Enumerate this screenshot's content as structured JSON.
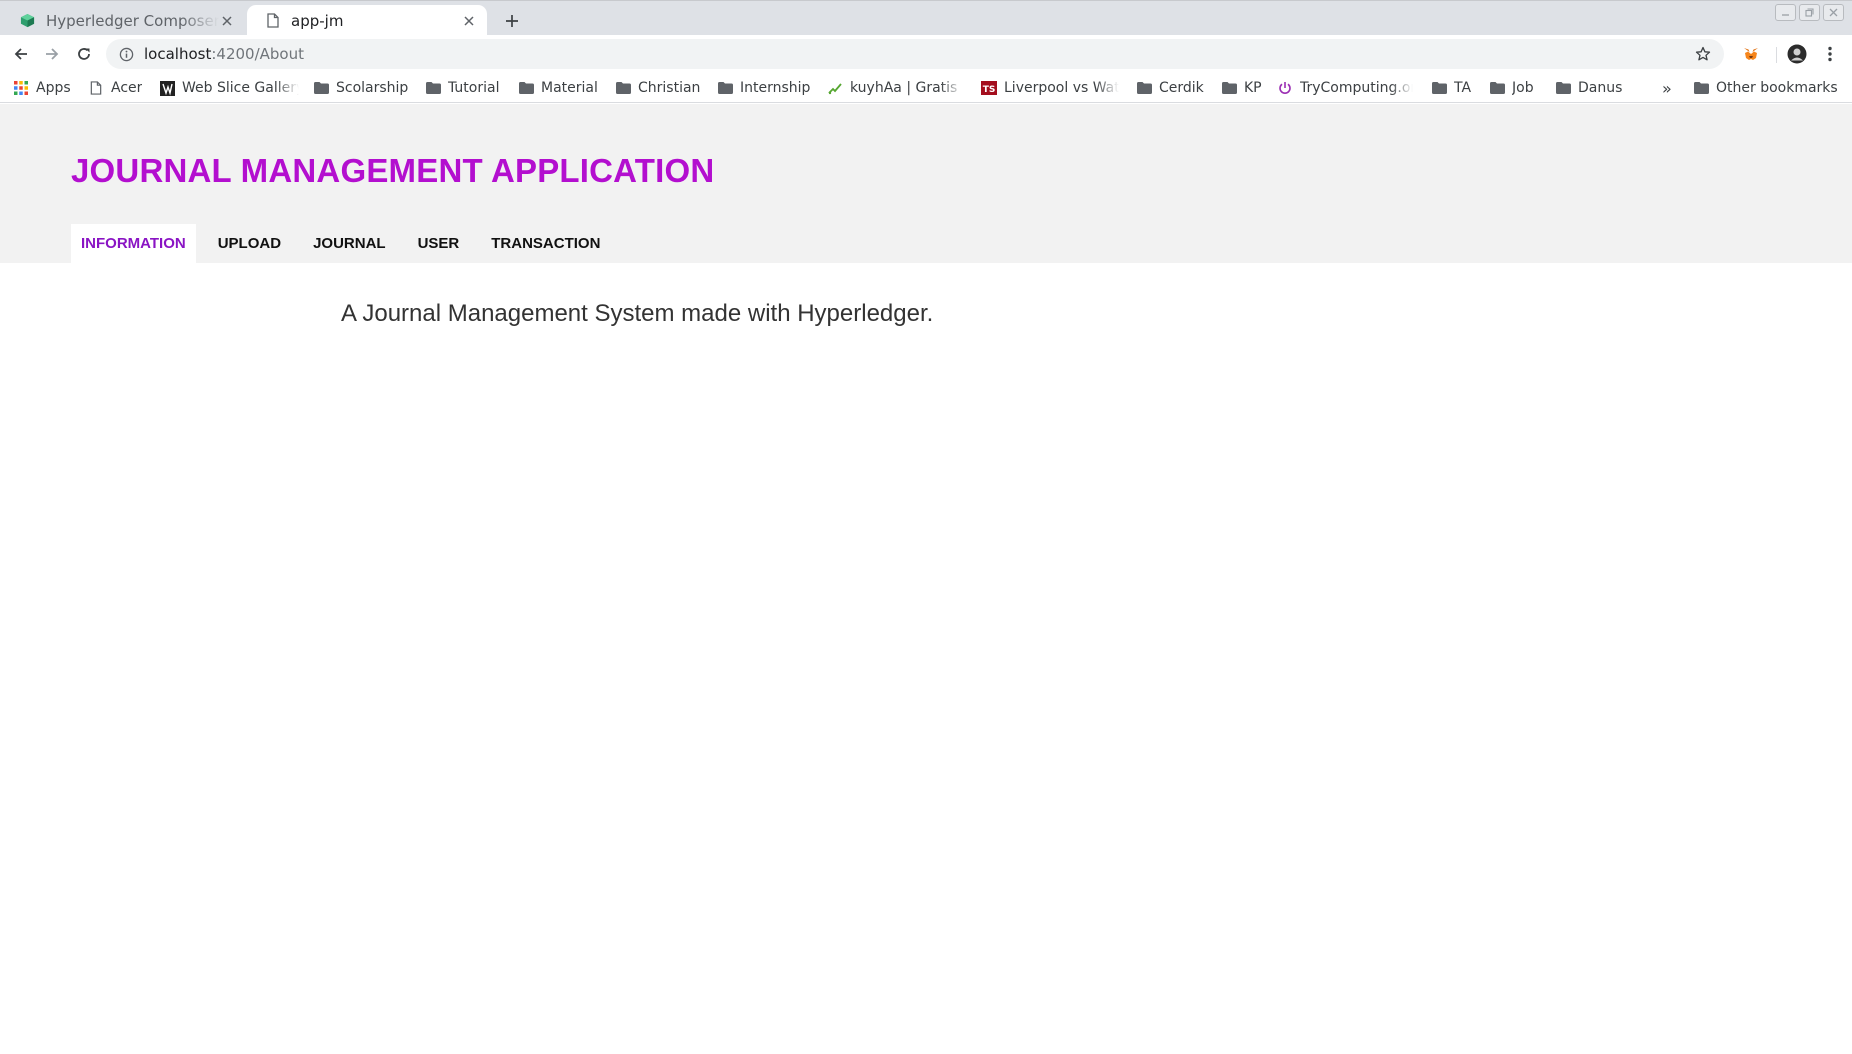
{
  "browser": {
    "tabs": [
      {
        "title": "Hyperledger Composer REST server",
        "active": false,
        "favicon": "cube-icon"
      },
      {
        "title": "app-jm",
        "active": true,
        "favicon": "page-icon"
      }
    ],
    "url": {
      "host": "localhost",
      "rest": ":4200/About"
    },
    "bookmarks": [
      {
        "label": "Apps",
        "icon": "apps-grid-icon"
      },
      {
        "label": "Acer",
        "icon": "page-icon"
      },
      {
        "label": "Web Slice Gallery",
        "icon": "web-slice-icon"
      },
      {
        "label": "Scolarship",
        "icon": "folder-icon"
      },
      {
        "label": "Tutorial",
        "icon": "folder-icon"
      },
      {
        "label": "Material",
        "icon": "folder-icon"
      },
      {
        "label": "Christian",
        "icon": "folder-icon"
      },
      {
        "label": "Internship",
        "icon": "folder-icon"
      },
      {
        "label": "kuyhAa | Gratis Download",
        "icon": "kuyhaa-icon"
      },
      {
        "label": "Liverpool vs Watford",
        "icon": "ts-icon"
      },
      {
        "label": "Cerdik",
        "icon": "folder-icon"
      },
      {
        "label": "KP",
        "icon": "folder-icon"
      },
      {
        "label": "TryComputing.org",
        "icon": "power-icon"
      },
      {
        "label": "TA",
        "icon": "folder-icon"
      },
      {
        "label": "Job",
        "icon": "folder-icon"
      },
      {
        "label": "Danus",
        "icon": "folder-icon"
      },
      {
        "label": "Other bookmarks",
        "icon": "folder-icon"
      }
    ],
    "overflow_label": "»"
  },
  "app": {
    "title": "JOURNAL MANAGEMENT APPLICATION",
    "nav": [
      {
        "label": "INFORMATION",
        "active": true
      },
      {
        "label": "UPLOAD",
        "active": false
      },
      {
        "label": "JOURNAL",
        "active": false
      },
      {
        "label": "USER",
        "active": false
      },
      {
        "label": "TRANSACTION",
        "active": false
      }
    ],
    "description": "A Journal Management System made with Hyperledger."
  },
  "colors": {
    "title_accent": "#b30fcf",
    "active_nav": "#8a14c4",
    "header_bg": "#f2f2f2"
  }
}
